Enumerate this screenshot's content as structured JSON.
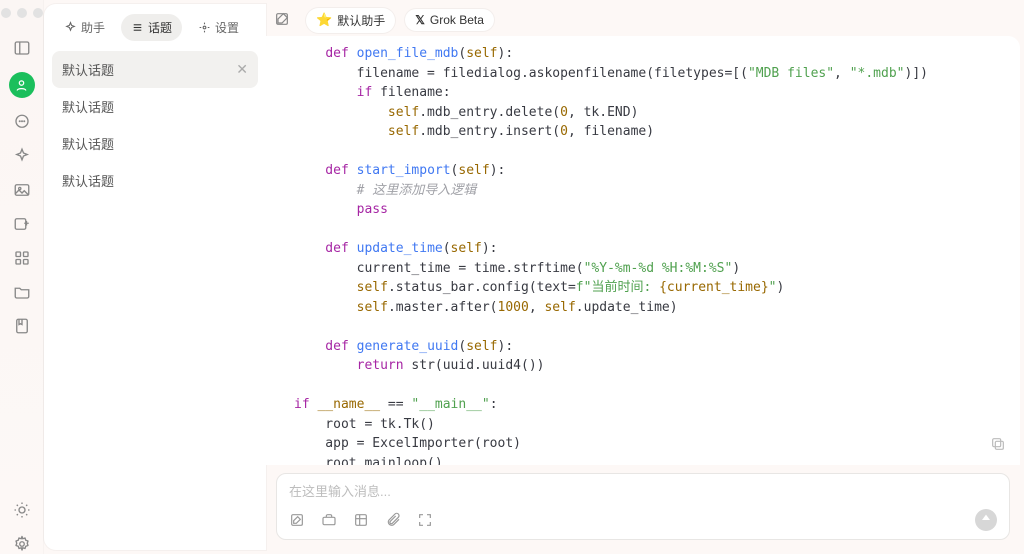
{
  "header": {
    "assistant_chip": "默认助手",
    "model_chip": "Grok Beta"
  },
  "sidebar": {
    "tabs": {
      "assistant": "助手",
      "topics": "话题",
      "settings": "设置",
      "active": "topics"
    },
    "topics": [
      "默认话题",
      "默认话题",
      "默认话题",
      "默认话题"
    ],
    "selected": 0
  },
  "composer": {
    "placeholder": "在这里输入消息..."
  },
  "code": {
    "l1": {
      "def": "def ",
      "fn": "open_file_mdb",
      "p": "(",
      "self": "self",
      "q": "):"
    },
    "l2": {
      "a": "        filename = filedialog.askopenfilename(filetypes=[(",
      "s1": "\"MDB files\"",
      "c": ", ",
      "s2": "\"*.mdb\"",
      "b": ")])"
    },
    "l3": {
      "a": "        ",
      "kw": "if",
      "b": " filename:"
    },
    "l4": {
      "a": "            ",
      "self": "self",
      "b": ".mdb_entry.delete(",
      "n": "0",
      "c": ", tk.END)"
    },
    "l5": {
      "a": "            ",
      "self": "self",
      "b": ".mdb_entry.insert(",
      "n": "0",
      "c": ", filename)"
    },
    "l7": {
      "def": "    def ",
      "fn": "start_import",
      "p": "(",
      "self": "self",
      "q": "):"
    },
    "l8": {
      "a": "        ",
      "cm": "# 这里添加导入逻辑"
    },
    "l9": {
      "a": "        ",
      "kw": "pass"
    },
    "l11": {
      "def": "    def ",
      "fn": "update_time",
      "p": "(",
      "self": "self",
      "q": "):"
    },
    "l12": {
      "a": "        current_time = time.strftime(",
      "s": "\"%Y-%m-%d %H:%M:%S\"",
      "b": ")"
    },
    "l13": {
      "a": "        ",
      "self": "self",
      "b": ".status_bar.config(text=",
      "fp": "f\"",
      "s1": "当前时间: ",
      "ob": "{current_time}",
      "fq": "\"",
      "c": ")"
    },
    "l14": {
      "a": "        ",
      "self": "self",
      "b": ".master.after(",
      "n": "1000",
      "c": ", ",
      "self2": "self",
      "d": ".update_time)"
    },
    "l16": {
      "def": "    def ",
      "fn": "generate_uuid",
      "p": "(",
      "self": "self",
      "q": "):"
    },
    "l17": {
      "a": "        ",
      "kw": "return",
      "b": " str(uuid.uuid4())"
    },
    "l19": {
      "kw": "if",
      "sp": " ",
      "d1": "__name__",
      "eq": " == ",
      "s": "\"__main__\"",
      "c": ":"
    },
    "l20": "    root = tk.Tk()",
    "l21": "    app = ExcelImporter(root)",
    "l22": "    root.mainloop()"
  }
}
